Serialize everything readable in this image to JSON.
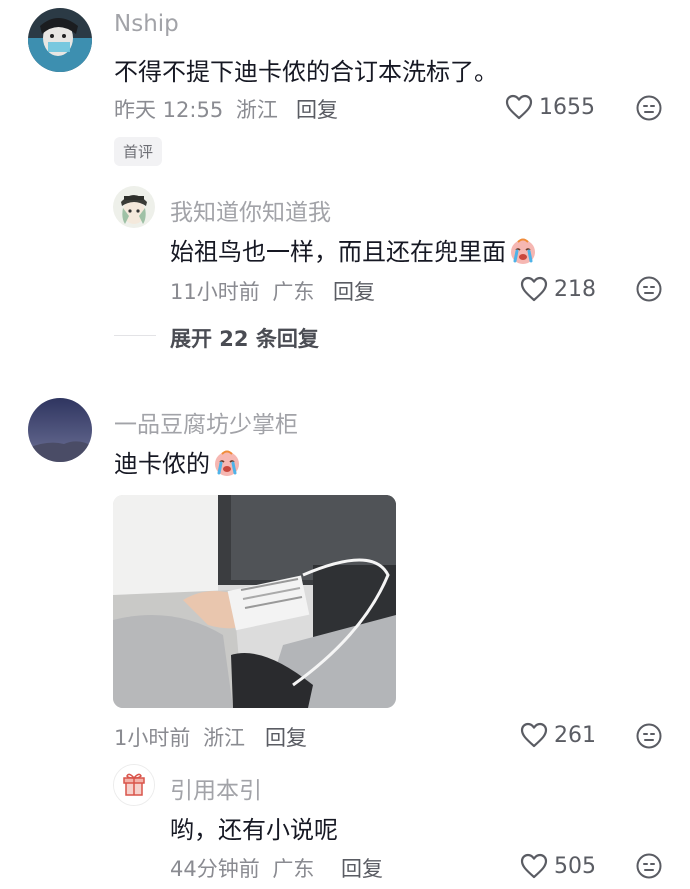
{
  "comments": [
    {
      "username": "Nship",
      "text": "不得不提下迪卡侬的合订本洗标了。",
      "time": "昨天 12:55",
      "location": "浙江",
      "reply_label": "回复",
      "likes": "1655",
      "badge": "首评",
      "replies": [
        {
          "username": "我知道你知道我",
          "text": "始祖鸟也一样，而且还在兜里面",
          "emoji": "crying-face",
          "time": "11小时前",
          "location": "广东",
          "reply_label": "回复",
          "likes": "218"
        }
      ],
      "expand_label": "展开 22 条回复"
    },
    {
      "username": "一品豆腐坊少掌柜",
      "text": "迪卡侬的",
      "emoji": "crying-face",
      "time": "1小时前",
      "location": "浙江",
      "reply_label": "回复",
      "likes": "261",
      "replies": [
        {
          "username": "引用本引",
          "text": "哟，还有小说呢",
          "time": "44分钟前",
          "location": "广东",
          "reply_label": "回复",
          "likes": "505"
        }
      ]
    }
  ],
  "icons": {
    "like": "heart-outline-icon",
    "dislike": "neutral-face-icon",
    "emoji": "crying-face-emoji",
    "gift_avatar": "gift-icon"
  },
  "colors": {
    "text_primary": "#161823",
    "text_secondary": "#8a8b91",
    "username": "#a2a3a8"
  }
}
